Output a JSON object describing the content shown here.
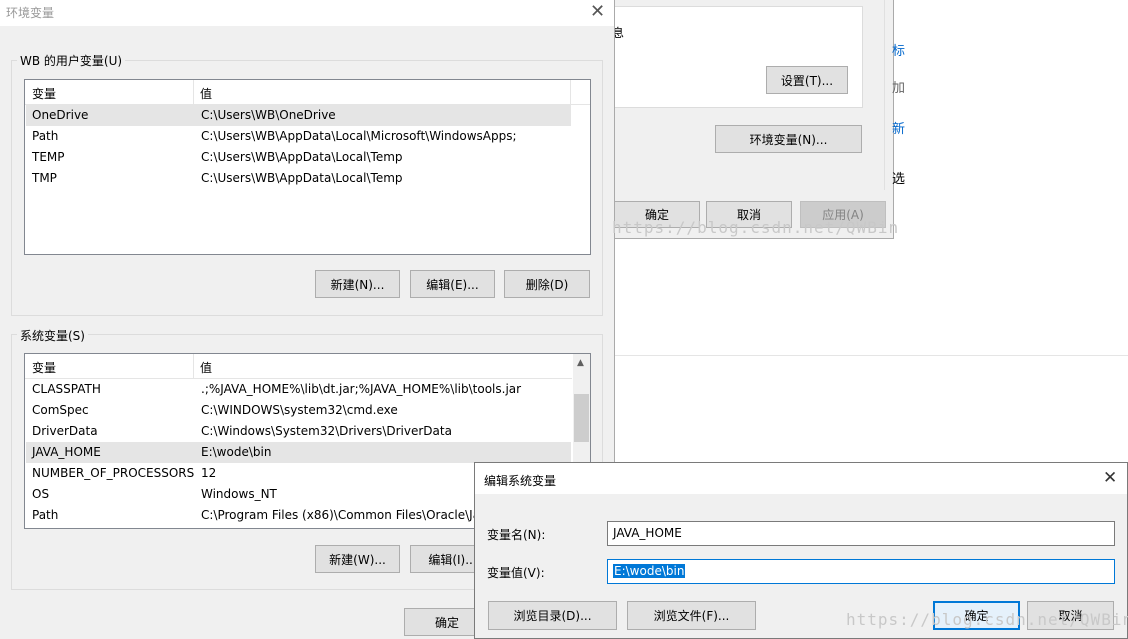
{
  "background_panel": {
    "settings_button": "设置(T)...",
    "env_button": "环境变量(N)...",
    "ok_button": "确定",
    "cancel_button": "取消",
    "apply_button": "应用(A)",
    "partial_text_1": "息",
    "right_edge_chars": [
      "标",
      "加",
      "新",
      "选"
    ]
  },
  "env_dialog": {
    "title": "环境变量",
    "user_group_label": "WB 的用户变量(U)",
    "columns": [
      "变量",
      "值"
    ],
    "user_vars": [
      {
        "name": "OneDrive",
        "value": "C:\\Users\\WB\\OneDrive"
      },
      {
        "name": "Path",
        "value": "C:\\Users\\WB\\AppData\\Local\\Microsoft\\WindowsApps;"
      },
      {
        "name": "TEMP",
        "value": "C:\\Users\\WB\\AppData\\Local\\Temp"
      },
      {
        "name": "TMP",
        "value": "C:\\Users\\WB\\AppData\\Local\\Temp"
      }
    ],
    "user_buttons": {
      "new": "新建(N)...",
      "edit": "编辑(E)...",
      "delete": "删除(D)"
    },
    "sys_group_label": "系统变量(S)",
    "sys_vars": [
      {
        "name": "CLASSPATH",
        "value": ".;%JAVA_HOME%\\lib\\dt.jar;%JAVA_HOME%\\lib\\tools.jar"
      },
      {
        "name": "ComSpec",
        "value": "C:\\WINDOWS\\system32\\cmd.exe"
      },
      {
        "name": "DriverData",
        "value": "C:\\Windows\\System32\\Drivers\\DriverData"
      },
      {
        "name": "JAVA_HOME",
        "value": "E:\\wode\\bin"
      },
      {
        "name": "NUMBER_OF_PROCESSORS",
        "value": "12"
      },
      {
        "name": "OS",
        "value": "Windows_NT"
      },
      {
        "name": "Path",
        "value": "C:\\Program Files (x86)\\Common Files\\Oracle\\Ja"
      }
    ],
    "sys_buttons": {
      "new": "新建(W)...",
      "edit": "编辑(I)..."
    },
    "ok_button": "确定"
  },
  "edit_dialog": {
    "title": "编辑系统变量",
    "name_label": "变量名(N):",
    "value_label": "变量值(V):",
    "name_value": "JAVA_HOME",
    "value_value": "E:\\wode\\bin",
    "browse_dir": "浏览目录(D)...",
    "browse_file": "浏览文件(F)...",
    "ok": "确定",
    "cancel": "取消"
  },
  "watermarks": [
    "https://blog.csdn.net/QWBin",
    "https://blog.csdn.net/QWBin"
  ],
  "colors": {
    "accent": "#0078d7",
    "selection": "#e5e5e5",
    "dialog_bg": "#f0f0f0"
  }
}
